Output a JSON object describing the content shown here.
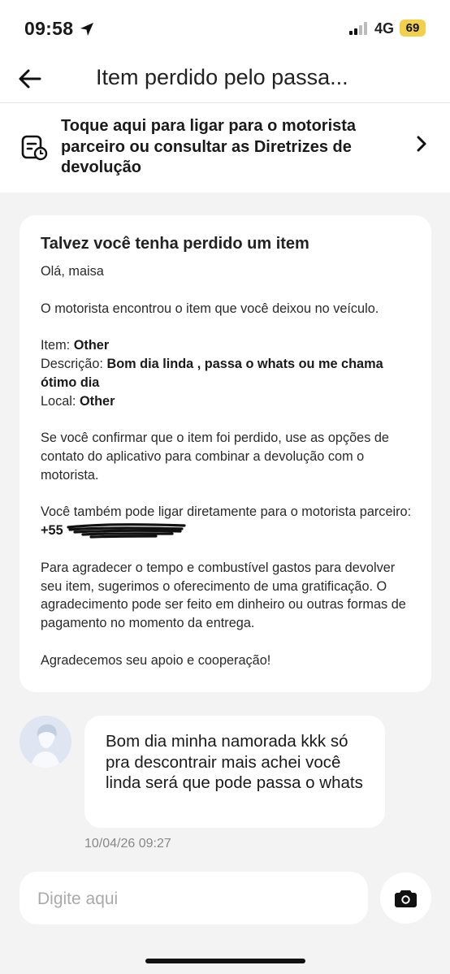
{
  "status_bar": {
    "time": "09:58",
    "network": "4G",
    "battery": "69"
  },
  "header": {
    "title": "Item perdido pelo passa..."
  },
  "banner": {
    "text": "Toque aqui para ligar para o motorista parceiro ou consultar as Diretrizes de devolução"
  },
  "card": {
    "title": "Talvez você tenha perdido um item",
    "greeting": "Olá, maisa",
    "found_text": "O motorista encontrou o item que você deixou no veículo.",
    "item_label": "Item:",
    "item_value": "Other",
    "description_label": "Descrição:",
    "description_value": "Bom dia linda , passa o whats ou me chama ótimo dia",
    "location_label": "Local:",
    "location_value": "Other",
    "confirm_text": "Se você confirmar que o item foi perdido, use as opções de contato do aplicativo para combinar a devolução com o motorista.",
    "call_text": "Você também pode ligar diretamente para o motorista parceiro:",
    "phone_prefix": "+55",
    "thanks_text": "Para agradecer o tempo e combustível gastos para devolver seu item, sugerimos o oferecimento de uma gratificação. O agradecimento pode ser feito em dinheiro ou outras formas de pagamento no momento da entrega.",
    "closing_text": "Agradecemos seu apoio e cooperação!"
  },
  "message": {
    "text": "Bom dia minha namorada kkk só pra descontrair mais achei você linda será que pode passa o whats",
    "timestamp": "10/04/26 09:27"
  },
  "composer": {
    "placeholder": "Digite aqui"
  },
  "icons": {
    "back": "arrow-left-icon",
    "banner": "document-clock-icon",
    "chevron": "chevron-right-icon",
    "camera": "camera-icon",
    "location": "location-arrow-icon"
  },
  "colors": {
    "background": "#f3f3f4",
    "battery": "#f3d04b"
  }
}
